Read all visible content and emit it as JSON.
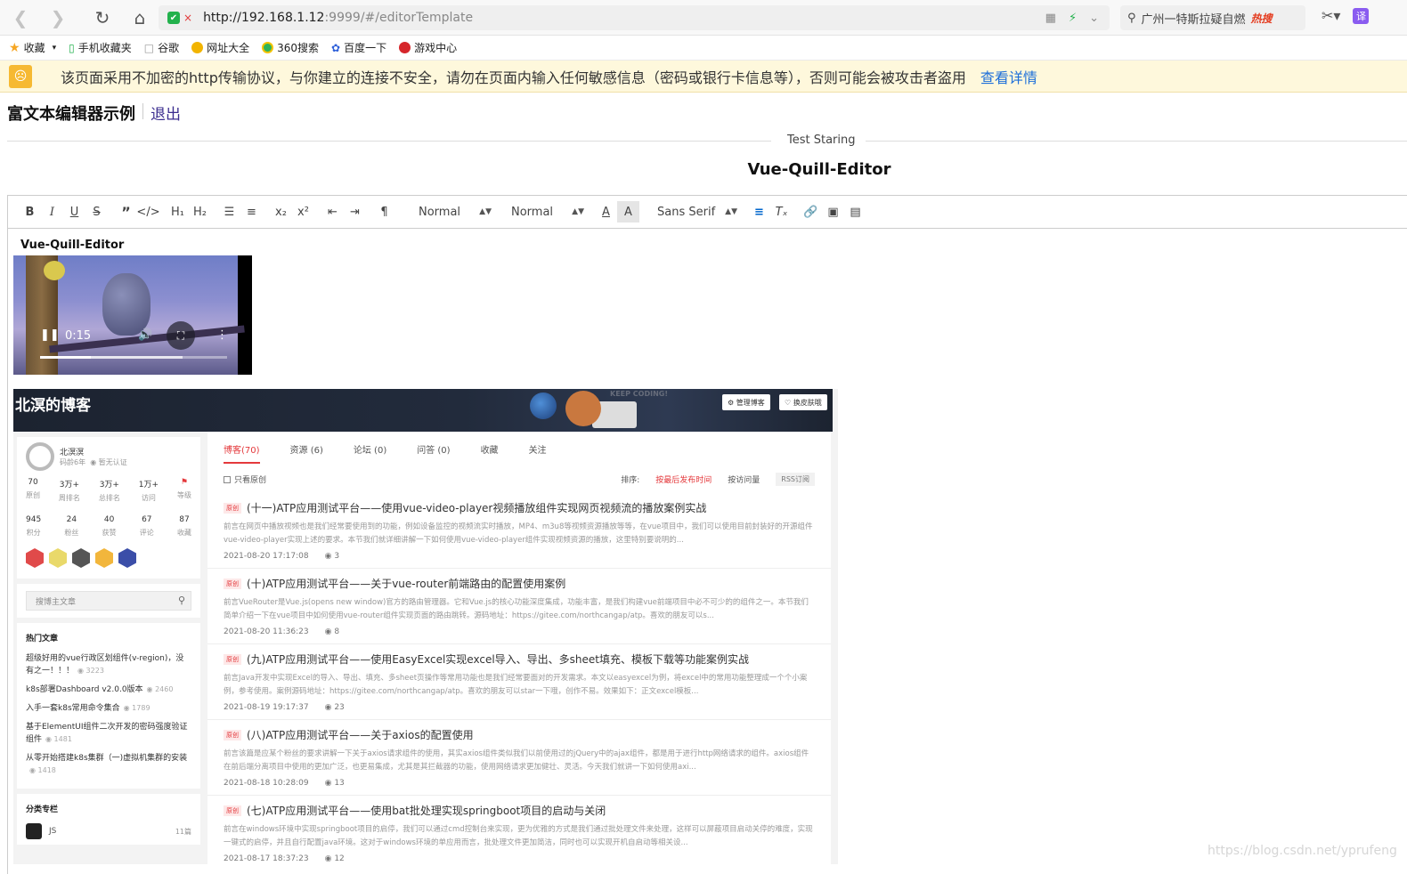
{
  "browser": {
    "url_host": "http://192.168.1.12",
    "url_rest": ":9999/#/editorTemplate",
    "search_text": "广州一特斯拉疑自燃",
    "hot_label": "热搜"
  },
  "bookmarks": [
    {
      "label": "收藏",
      "icon": "star-icon"
    },
    {
      "label": "手机收藏夹",
      "icon": "phone-icon"
    },
    {
      "label": "谷歌",
      "icon": "page-icon"
    },
    {
      "label": "网址大全",
      "icon": "sites-icon"
    },
    {
      "label": "360搜索",
      "icon": "360-icon"
    },
    {
      "label": "百度一下",
      "icon": "baidu-icon"
    },
    {
      "label": "游戏中心",
      "icon": "game-icon"
    }
  ],
  "security": {
    "message": "该页面采用不加密的http传输协议，与你建立的连接不安全，请勿在页面内输入任何敏感信息（密码或银行卡信息等），否则可能会被攻击者盗用",
    "link": "查看详情"
  },
  "page": {
    "title": "富文本编辑器示例",
    "logout": "退出",
    "divider_text": "Test Staring",
    "editor_title": "Vue-Quill-Editor"
  },
  "toolbar": {
    "header_select": "Normal",
    "size_select": "Normal",
    "font_select": "Sans Serif",
    "buttons": [
      "bold-icon",
      "italic-icon",
      "underline-icon",
      "strike-icon",
      "blockquote-icon",
      "code-block-icon",
      "h1-icon",
      "h2-icon",
      "ordered-list-icon",
      "bullet-list-icon",
      "subscript-icon",
      "superscript-icon",
      "outdent-icon",
      "indent-icon",
      "rtl-icon",
      "font-color-icon",
      "background-color-icon",
      "align-icon",
      "clean-icon",
      "link-icon",
      "image-icon",
      "video-icon"
    ]
  },
  "content": {
    "heading": "Vue-Quill-Editor",
    "video_time": "0:15",
    "video_progress": 0.27
  },
  "blog": {
    "title": "北溟的博客",
    "manage_btn": "管理博客",
    "skin_btn": "换皮肤哦",
    "keep_coding": "KEEP CODING!",
    "profile_name": "北溟溟",
    "profile_age": "码龄6年",
    "profile_cert": "暂无认证",
    "stats1": [
      {
        "v": "70",
        "l": "原创"
      },
      {
        "v": "3万+",
        "l": "周排名"
      },
      {
        "v": "3万+",
        "l": "总排名"
      },
      {
        "v": "1万+",
        "l": "访问"
      },
      {
        "v": "",
        "l": "等级"
      }
    ],
    "stats2": [
      {
        "v": "945",
        "l": "积分"
      },
      {
        "v": "24",
        "l": "粉丝"
      },
      {
        "v": "40",
        "l": "获赞"
      },
      {
        "v": "67",
        "l": "评论"
      },
      {
        "v": "87",
        "l": "收藏"
      }
    ],
    "search_placeholder": "搜博主文章",
    "hot_title": "热门文章",
    "hot": [
      {
        "t": "超级好用的vue行政区划组件(v-region)，没有之一！！！",
        "c": "3223"
      },
      {
        "t": "k8s部署Dashboard v2.0.0版本",
        "c": "2460"
      },
      {
        "t": "入手一套k8s常用命令集合",
        "c": "1789"
      },
      {
        "t": "基于ElementUI组件二次开发的密码强度验证组件",
        "c": "1481"
      },
      {
        "t": "从零开始搭建k8s集群（一)虚拟机集群的安装",
        "c": "1418"
      }
    ],
    "cat_title": "分类专栏",
    "cat_item": "JS",
    "cat_count": "11篇",
    "tabs": [
      "博客(70)",
      "资源 (6)",
      "论坛 (0)",
      "问答 (0)",
      "收藏",
      "关注"
    ],
    "only_original": "只看原创",
    "sort_label": "排序:",
    "sort_latest": "按最后发布时间",
    "sort_visits": "按访问量",
    "rss": "RSS订阅",
    "tag": "原创",
    "articles": [
      {
        "title": "(十一)ATP应用测试平台——使用vue-video-player视频播放组件实现网页视频流的播放案例实战",
        "desc": "前言在网页中播放视频也是我们经常要使用到的功能，例如设备监控的视频流实时播放，MP4、m3u8等视频资源播放等等，在vue项目中，我们可以使用目前封装好的开源组件vue-video-player实现上述的要求。本节我们就详细讲解一下如何使用vue-video-player组件实现视频资源的播放，这里特别要说明的...",
        "date": "2021-08-20 17:17:08",
        "comments": "3"
      },
      {
        "title": "(十)ATP应用测试平台——关于vue-router前端路由的配置使用案例",
        "desc": "前言VueRouter是Vue.js(opens new window)官方的路由管理器。它和Vue.js的核心功能深度集成，功能丰富，是我们构建vue前端项目中必不可少的的组件之一。本节我们简单介绍一下在vue项目中如何使用vue-router组件实现页面的路由跳转。源码地址：https://gitee.com/northcangap/atp。喜欢的朋友可以s...",
        "date": "2021-08-20 11:36:23",
        "comments": "8"
      },
      {
        "title": "(九)ATP应用测试平台——使用EasyExcel实现excel导入、导出、多sheet填充、模板下载等功能案例实战",
        "desc": "前言Java开发中实现Excel的导入、导出、填充、多sheet页操作等常用功能也是我们经常要面对的开发需求。本文以easyexcel为例，将excel中的常用功能整理成一个个小案例，参考使用。案例源码地址：https://gitee.com/northcangap/atp。喜欢的朋友可以star一下哦，创作不易。效果如下：正文excel模板...",
        "date": "2021-08-19 19:17:37",
        "comments": "23"
      },
      {
        "title": "(八)ATP应用测试平台——关于axios的配置使用",
        "desc": "前言该篇是应某个粉丝的要求讲解一下关于axios请求组件的使用，其实axios组件类似我们以前使用过的jQuery中的ajax组件，都是用于进行http网络请求的组件。axios组件在前后端分离项目中使用的更加广泛，也更易集成，尤其是其拦截器的功能，使用网络请求更加健壮、灵活。今天我们就讲一下如何使用axi...",
        "date": "2021-08-18 10:28:09",
        "comments": "13"
      },
      {
        "title": "(七)ATP应用测试平台——使用bat批处理实现springboot项目的启动与关闭",
        "desc": "前言在windows环境中实现springboot项目的启停，我们可以通过cmd控制台来实现，更为优雅的方式是我们通过批处理文件来处理，这样可以屏蔽项目启动关停的难度，实现一键式的启停，并且自行配置java环境。这对于windows环境的单应用而言，批处理文件更加简洁，同时也可以实现开机自启动等相关设...",
        "date": "2021-08-17 18:37:23",
        "comments": "12"
      }
    ]
  },
  "watermark": "https://blog.csdn.net/yprufeng"
}
